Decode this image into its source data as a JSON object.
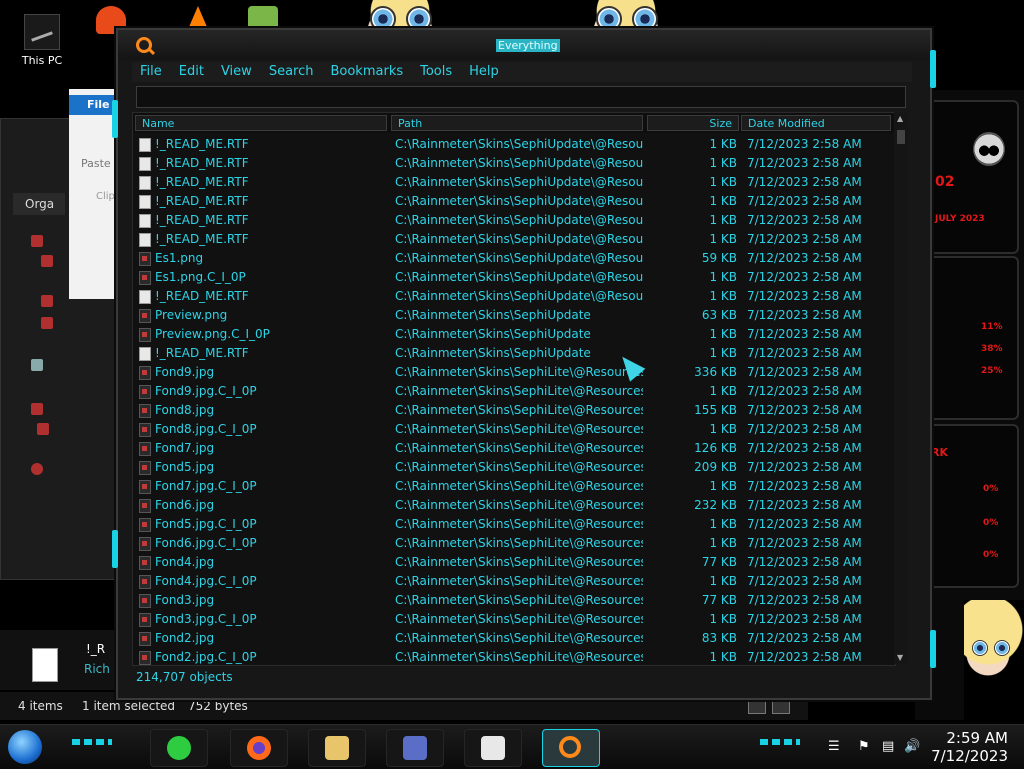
{
  "desktop": {
    "this_pc_label": "This PC"
  },
  "explorer": {
    "file_tab": "File",
    "paste_label": "Paste",
    "clip_label": "Clip",
    "organize_label": "Orga",
    "selected_name": "!_R",
    "selected_type": "Rich",
    "status": {
      "items": "4 items",
      "selected": "1 item selected",
      "size": "752 bytes"
    }
  },
  "window": {
    "title": "Everything",
    "menu": [
      "File",
      "Edit",
      "View",
      "Search",
      "Bookmarks",
      "Tools",
      "Help"
    ],
    "search_value": "",
    "columns": {
      "name": "Name",
      "path": "Path",
      "size": "Size",
      "date": "Date Modified"
    },
    "rows": [
      {
        "name": "!_READ_ME.RTF",
        "type": "doc",
        "path": "C:\\Rainmeter\\Skins\\SephiUpdate\\@Resources\\...",
        "size": "1 KB",
        "date": "7/12/2023 2:58 AM"
      },
      {
        "name": "!_READ_ME.RTF",
        "type": "doc",
        "path": "C:\\Rainmeter\\Skins\\SephiUpdate\\@Resources\\...",
        "size": "1 KB",
        "date": "7/12/2023 2:58 AM"
      },
      {
        "name": "!_READ_ME.RTF",
        "type": "doc",
        "path": "C:\\Rainmeter\\Skins\\SephiUpdate\\@Resources\\...",
        "size": "1 KB",
        "date": "7/12/2023 2:58 AM"
      },
      {
        "name": "!_READ_ME.RTF",
        "type": "doc",
        "path": "C:\\Rainmeter\\Skins\\SephiUpdate\\@Resources\\...",
        "size": "1 KB",
        "date": "7/12/2023 2:58 AM"
      },
      {
        "name": "!_READ_ME.RTF",
        "type": "doc",
        "path": "C:\\Rainmeter\\Skins\\SephiUpdate\\@Resources\\...",
        "size": "1 KB",
        "date": "7/12/2023 2:58 AM"
      },
      {
        "name": "!_READ_ME.RTF",
        "type": "doc",
        "path": "C:\\Rainmeter\\Skins\\SephiUpdate\\@Resources\\L...",
        "size": "1 KB",
        "date": "7/12/2023 2:58 AM"
      },
      {
        "name": "Es1.png",
        "type": "img",
        "path": "C:\\Rainmeter\\Skins\\SephiUpdate\\@Resources\\I...",
        "size": "59 KB",
        "date": "7/12/2023 2:58 AM"
      },
      {
        "name": "Es1.png.C_I_0P",
        "type": "img",
        "path": "C:\\Rainmeter\\Skins\\SephiUpdate\\@Resources\\I...",
        "size": "1 KB",
        "date": "7/12/2023 2:58 AM"
      },
      {
        "name": "!_READ_ME.RTF",
        "type": "doc",
        "path": "C:\\Rainmeter\\Skins\\SephiUpdate\\@Resources\\I...",
        "size": "1 KB",
        "date": "7/12/2023 2:58 AM"
      },
      {
        "name": "Preview.png",
        "type": "img",
        "path": "C:\\Rainmeter\\Skins\\SephiUpdate",
        "size": "63 KB",
        "date": "7/12/2023 2:58 AM"
      },
      {
        "name": "Preview.png.C_I_0P",
        "type": "img",
        "path": "C:\\Rainmeter\\Skins\\SephiUpdate",
        "size": "1 KB",
        "date": "7/12/2023 2:58 AM"
      },
      {
        "name": "!_READ_ME.RTF",
        "type": "doc",
        "path": "C:\\Rainmeter\\Skins\\SephiUpdate",
        "size": "1 KB",
        "date": "7/12/2023 2:58 AM"
      },
      {
        "name": "Fond9.jpg",
        "type": "img",
        "path": "C:\\Rainmeter\\Skins\\SephiLite\\@Resources\\Slid...",
        "size": "336 KB",
        "date": "7/12/2023 2:58 AM"
      },
      {
        "name": "Fond9.jpg.C_I_0P",
        "type": "img",
        "path": "C:\\Rainmeter\\Skins\\SephiLite\\@Resources\\Slidel...",
        "size": "1 KB",
        "date": "7/12/2023 2:58 AM"
      },
      {
        "name": "Fond8.jpg",
        "type": "img",
        "path": "C:\\Rainmeter\\Skins\\SephiLite\\@Resources\\Slidel...",
        "size": "155 KB",
        "date": "7/12/2023 2:58 AM"
      },
      {
        "name": "Fond8.jpg.C_I_0P",
        "type": "img",
        "path": "C:\\Rainmeter\\Skins\\SephiLite\\@Resources\\Slidel...",
        "size": "1 KB",
        "date": "7/12/2023 2:58 AM"
      },
      {
        "name": "Fond7.jpg",
        "type": "img",
        "path": "C:\\Rainmeter\\Skins\\SephiLite\\@Resources\\Slidel...",
        "size": "126 KB",
        "date": "7/12/2023 2:58 AM"
      },
      {
        "name": "Fond5.jpg",
        "type": "img",
        "path": "C:\\Rainmeter\\Skins\\SephiLite\\@Resources\\Slidel...",
        "size": "209 KB",
        "date": "7/12/2023 2:58 AM"
      },
      {
        "name": "Fond7.jpg.C_I_0P",
        "type": "img",
        "path": "C:\\Rainmeter\\Skins\\SephiLite\\@Resources\\Slidel...",
        "size": "1 KB",
        "date": "7/12/2023 2:58 AM"
      },
      {
        "name": "Fond6.jpg",
        "type": "img",
        "path": "C:\\Rainmeter\\Skins\\SephiLite\\@Resources\\Slidel...",
        "size": "232 KB",
        "date": "7/12/2023 2:58 AM"
      },
      {
        "name": "Fond5.jpg.C_I_0P",
        "type": "img",
        "path": "C:\\Rainmeter\\Skins\\SephiLite\\@Resources\\Slidel...",
        "size": "1 KB",
        "date": "7/12/2023 2:58 AM"
      },
      {
        "name": "Fond6.jpg.C_I_0P",
        "type": "img",
        "path": "C:\\Rainmeter\\Skins\\SephiLite\\@Resources\\Slidel...",
        "size": "1 KB",
        "date": "7/12/2023 2:58 AM"
      },
      {
        "name": "Fond4.jpg",
        "type": "img",
        "path": "C:\\Rainmeter\\Skins\\SephiLite\\@Resources\\Slidel...",
        "size": "77 KB",
        "date": "7/12/2023 2:58 AM"
      },
      {
        "name": "Fond4.jpg.C_I_0P",
        "type": "img",
        "path": "C:\\Rainmeter\\Skins\\SephiLite\\@Resources\\Slidel...",
        "size": "1 KB",
        "date": "7/12/2023 2:58 AM"
      },
      {
        "name": "Fond3.jpg",
        "type": "img",
        "path": "C:\\Rainmeter\\Skins\\SephiLite\\@Resources\\Slidel...",
        "size": "77 KB",
        "date": "7/12/2023 2:58 AM"
      },
      {
        "name": "Fond3.jpg.C_I_0P",
        "type": "img",
        "path": "C:\\Rainmeter\\Skins\\SephiLite\\@Resources\\Slidel...",
        "size": "1 KB",
        "date": "7/12/2023 2:58 AM"
      },
      {
        "name": "Fond2.jpg",
        "type": "img",
        "path": "C:\\Rainmeter\\Skins\\SephiLite\\@Resources\\Slidel...",
        "size": "83 KB",
        "date": "7/12/2023 2:58 AM"
      },
      {
        "name": "Fond2.jpg.C_I_0P",
        "type": "img",
        "path": "C:\\Rainmeter\\Skins\\SephiLite\\@Resources\\Slidel...",
        "size": "1 KB",
        "date": "7/12/2023 2:58 AM"
      }
    ],
    "status": "214,707 objects"
  },
  "skin": {
    "value_1": "02",
    "value_2": "JULY 2023",
    "pct_1": "11%",
    "pct_2": "38%",
    "pct_3": "25%",
    "label_rk": "RK",
    "pct_4": "0%",
    "pct_5": "0%",
    "pct_6": "0%"
  },
  "taskbar": {
    "time": "2:59 AM",
    "date": "7/12/2023"
  },
  "colors": {
    "accent": "#2ed3e6",
    "background": "#111111",
    "skin_red": "#e01818"
  },
  "icons": {
    "app": "magnifier-icon",
    "doc": "rtf-document-icon",
    "img": "image-file-icon",
    "start": "windows-orb-icon"
  }
}
